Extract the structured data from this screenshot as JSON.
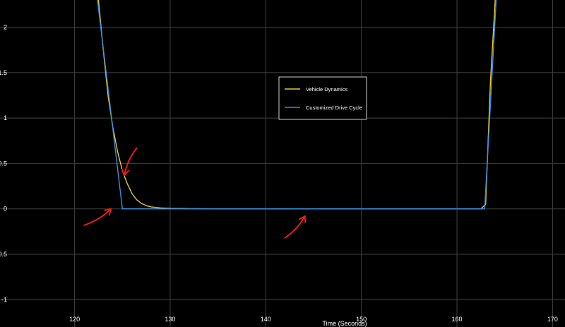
{
  "chart_data": {
    "type": "line",
    "title": "",
    "xlabel": "Time (Seconds)",
    "ylabel": "",
    "xlim": [
      112.2,
      171.3
    ],
    "ylim": [
      -1.2,
      2.3
    ],
    "xticks": [
      120,
      130,
      140,
      150,
      160,
      170
    ],
    "yticks": [
      -1,
      -0.5,
      0,
      0.5,
      1,
      1.5,
      2
    ],
    "grid": true,
    "legend": "center",
    "colors": {
      "background": "#000000",
      "grid": "#404040",
      "text": "#ffffff",
      "annotation": "#ff1a1a"
    },
    "series": [
      {
        "name": "Vehicle Dynamics",
        "color": "#e5c93a",
        "x": [
          122.5,
          123.0,
          123.5,
          124.0,
          124.5,
          125.0,
          125.5,
          126.0,
          126.5,
          127.0,
          127.5,
          128.0,
          129.0,
          130.0,
          132.0,
          135.0,
          140.0,
          150.0,
          160.0,
          162.5,
          163.0,
          163.5,
          164.0
        ],
        "y": [
          2.3,
          1.75,
          1.25,
          0.9,
          0.63,
          0.42,
          0.28,
          0.17,
          0.1,
          0.06,
          0.035,
          0.022,
          0.01,
          0.005,
          0.002,
          0.0,
          0.0,
          0.0,
          0.0,
          0.0,
          0.05,
          1.4,
          2.3
        ]
      },
      {
        "name": "Customized Drive Cycle",
        "color": "#3d8fe0",
        "x": [
          122.4,
          125.0,
          140.0,
          150.0,
          160.0,
          162.9,
          164.1
        ],
        "y": [
          2.3,
          0.0,
          0.0,
          0.0,
          0.0,
          0.0,
          2.3
        ]
      }
    ],
    "annotations": [
      {
        "type": "arrow",
        "from": [
          121.0,
          -0.18
        ],
        "to": [
          123.8,
          0.0
        ]
      },
      {
        "type": "arrow",
        "from": [
          126.5,
          0.67
        ],
        "to": [
          125.2,
          0.37
        ]
      },
      {
        "type": "arrow",
        "from": [
          142.0,
          -0.32
        ],
        "to": [
          144.1,
          -0.08
        ]
      }
    ]
  }
}
